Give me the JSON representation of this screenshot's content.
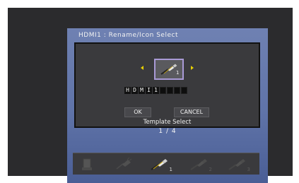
{
  "dialog": {
    "title": "HDMI1 : Rename/Icon Select"
  },
  "icon_selector": {
    "selected_number": "1"
  },
  "name_chars": [
    "H",
    "D",
    "M",
    "I",
    "1",
    "",
    "",
    "",
    ""
  ],
  "buttons": {
    "ok": "OK",
    "cancel": "CANCEL",
    "template": "Template Select"
  },
  "page_indicator": "1 / 4",
  "icon_strip": [
    {
      "name": "device-icon",
      "number": ""
    },
    {
      "name": "plug-icon",
      "number": ""
    },
    {
      "name": "hdmi-cable-icon",
      "number": "1"
    },
    {
      "name": "hdmi-cable-icon",
      "number": "2"
    },
    {
      "name": "hdmi-cable-icon",
      "number": "3"
    }
  ],
  "colors": {
    "accent": "#e8d000",
    "selection_border": "#a99ad6",
    "dialog_bg": "#6f81b2"
  }
}
